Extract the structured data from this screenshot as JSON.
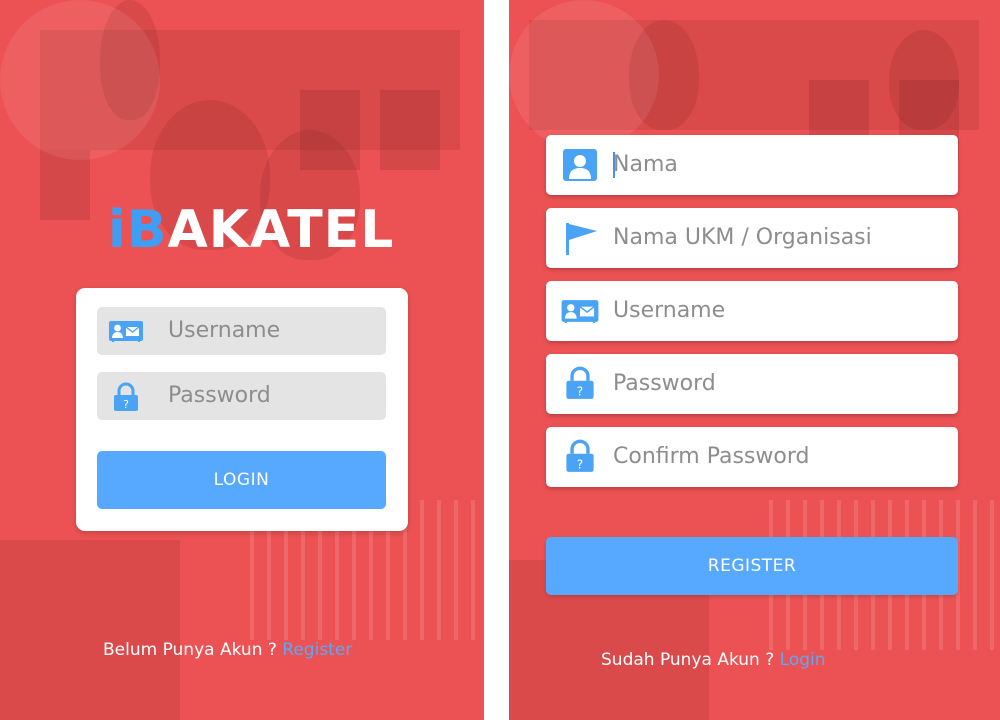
{
  "login_screen": {
    "logo": {
      "i": "i",
      "b": "B",
      "rest": "AKATEL"
    },
    "username_placeholder": "Username",
    "password_placeholder": "Password",
    "login_button": "LOGIN",
    "footer_text": "Belum Punya Akun ? ",
    "footer_link": "Register"
  },
  "register_screen": {
    "nama_placeholder": "Nama",
    "ukm_placeholder": "Nama UKM / Organisasi",
    "username_placeholder": "Username",
    "password_placeholder": "Password",
    "confirm_placeholder": "Confirm Password",
    "register_button": "REGISTER",
    "footer_text": "Sudah Punya Akun ? ",
    "footer_link": "Login"
  },
  "icons": {
    "contact_card": "contact-card-icon",
    "lock": "lock-icon",
    "user": "user-icon",
    "flag": "flag-icon"
  },
  "colors": {
    "background": "#ec5253",
    "accent_blue": "#56a9ff",
    "logo_blue": "#3f9df3",
    "link_blue": "#5aa8f7",
    "placeholder": "#8d8d8d"
  }
}
